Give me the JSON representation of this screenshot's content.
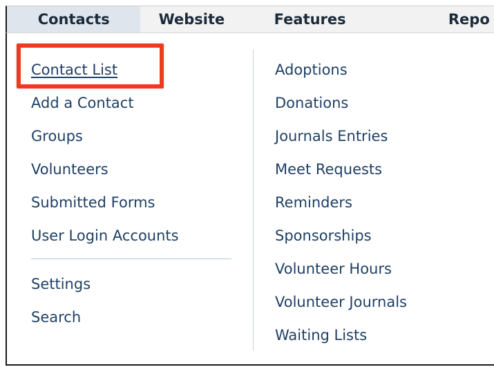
{
  "nav": {
    "tabs": [
      {
        "label": "Contacts"
      },
      {
        "label": "Website"
      },
      {
        "label": "Features"
      },
      {
        "label": "Repo"
      }
    ]
  },
  "menu": {
    "left": [
      {
        "label": "Contact List"
      },
      {
        "label": "Add a Contact"
      },
      {
        "label": "Groups"
      },
      {
        "label": "Volunteers"
      },
      {
        "label": "Submitted Forms"
      },
      {
        "label": "User Login Accounts"
      },
      {
        "label": "Settings"
      },
      {
        "label": "Search"
      }
    ],
    "right": [
      {
        "label": "Adoptions"
      },
      {
        "label": "Donations"
      },
      {
        "label": "Journals Entries"
      },
      {
        "label": "Meet Requests"
      },
      {
        "label": "Reminders"
      },
      {
        "label": "Sponsorships"
      },
      {
        "label": "Volunteer Hours"
      },
      {
        "label": "Volunteer Journals"
      },
      {
        "label": "Waiting Lists"
      }
    ]
  },
  "colors": {
    "highlight": "#ee3a1f",
    "link": "#1e3f64",
    "active_tab": "#dfe5ec"
  }
}
